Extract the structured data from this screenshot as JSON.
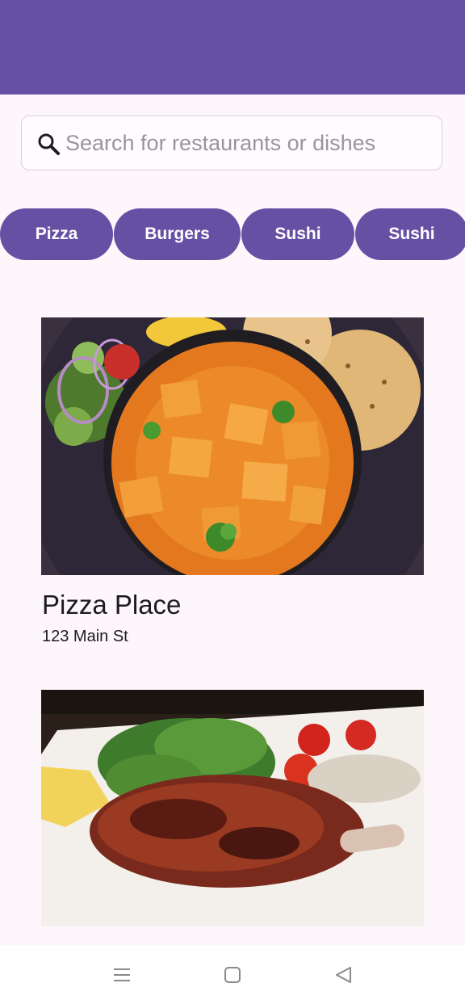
{
  "colors": {
    "primary": "#6650a4",
    "background": "#fdf7fc",
    "chip_text": "#ffffff",
    "placeholder": "#9a959c"
  },
  "search": {
    "icon": "search-icon",
    "value": "",
    "placeholder": "Search for restaurants or dishes"
  },
  "categories": [
    {
      "label": "Pizza"
    },
    {
      "label": "Burgers"
    },
    {
      "label": "Sushi"
    },
    {
      "label": "Sushi"
    }
  ],
  "restaurants": [
    {
      "name": "Pizza Place",
      "address": "123 Main St"
    }
  ],
  "nav": {
    "icons": [
      "menu-icon",
      "home-icon",
      "back-icon"
    ]
  }
}
